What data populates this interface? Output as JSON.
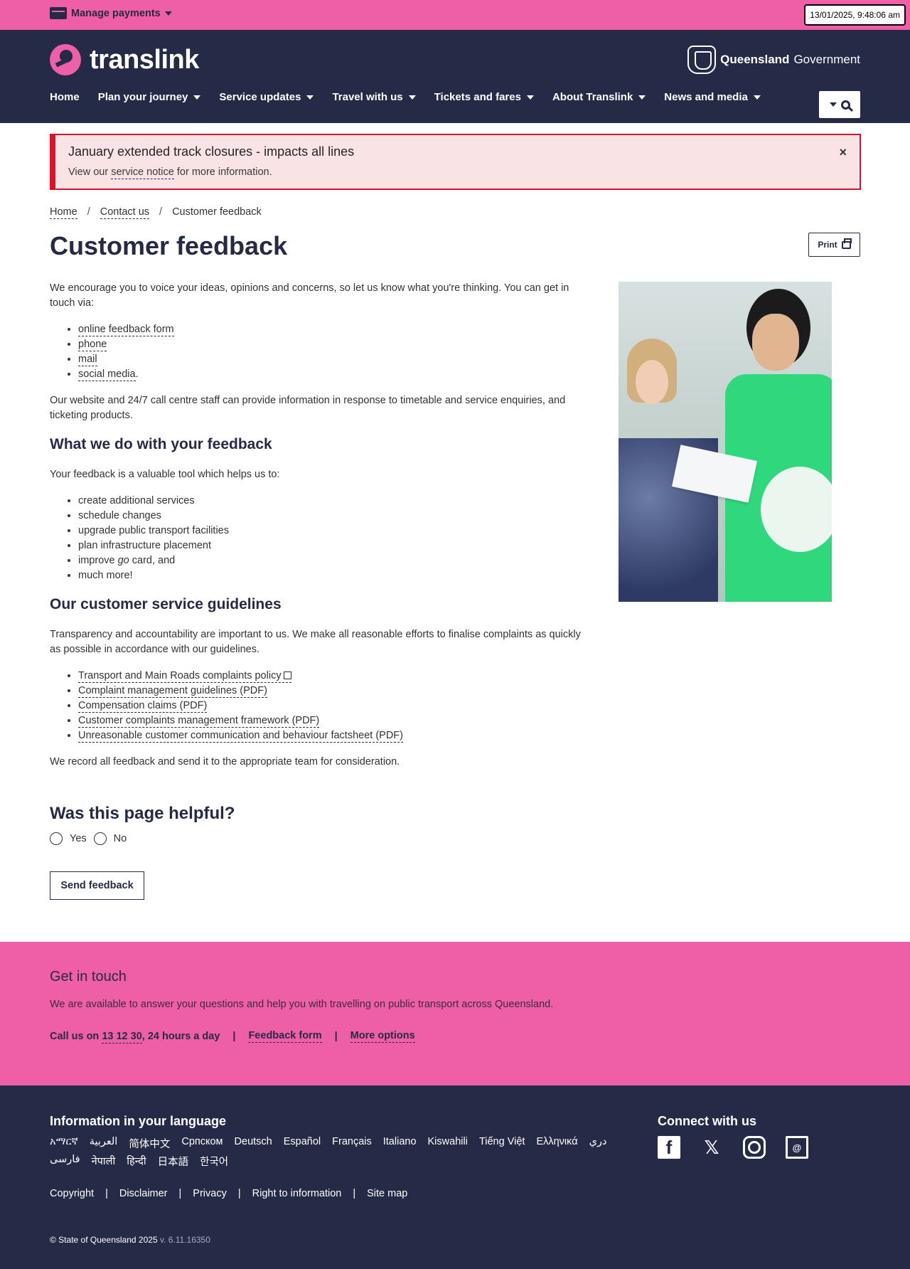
{
  "topbar": {
    "manage_label": "Manage payments",
    "timestamp": "13/01/2025, 9:48:06 am"
  },
  "header": {
    "logo_text": "translink",
    "qgov_bold": "Queensland",
    "qgov_rest": " Government",
    "nav": [
      "Home",
      "Plan your journey",
      "Service updates",
      "Travel with us",
      "Tickets and fares",
      "About Translink",
      "News and media"
    ]
  },
  "alert": {
    "title": "January extended track closures - impacts all lines",
    "text_before": "View our ",
    "link": "service notice",
    "text_after": " for more information.",
    "close": "×"
  },
  "breadcrumb": [
    "Home",
    "/",
    "Contact us",
    "/",
    "Customer feedback"
  ],
  "page": {
    "title": "Customer feedback",
    "print_label": "Print",
    "intro": "We encourage you to voice your ideas, opinions and concerns, so let us know what you're thinking. You can get in touch via:",
    "contact_links": [
      "online feedback form",
      "phone",
      "mail",
      "social media"
    ],
    "social_suffix": ".",
    "website_text": "Our website and 24/7 call centre staff can provide information in response to timetable and service enquiries, and ticketing products.",
    "h_what": "What we do with your feedback",
    "what_intro": "Your feedback is a valuable tool which helps us to:",
    "what_items": [
      "create additional services",
      "schedule changes",
      "upgrade public transport facilities",
      "plan infrastructure placement"
    ],
    "improve_before": "improve ",
    "improve_go": "go",
    "improve_after": " card, and",
    "much_more": "much more!",
    "h_guidelines": "Our customer service guidelines",
    "guidelines_intro": "Transparency and accountability are important to us. We make all reasonable efforts to finalise complaints as quickly as possible in accordance with our guidelines.",
    "guideline_links": [
      "Transport and Main Roads complaints policy",
      "Complaint management guidelines (PDF)",
      "Compensation claims (PDF)",
      "Customer complaints management framework (PDF)",
      "Unreasonable customer communication and behaviour factsheet (PDF)"
    ],
    "record_text": "We record all feedback and send it to the appropriate team for consideration."
  },
  "helpful": {
    "title": "Was this page helpful?",
    "yes": "Yes",
    "no": "No",
    "send": "Send feedback"
  },
  "get_in_touch": {
    "title": "Get in touch",
    "text": "We are available to answer your questions and help you with travelling on public transport across Queensland.",
    "call_before": "Call us on ",
    "phone": "13 12 30",
    "call_after": ", 24 hours a day",
    "sep": "|",
    "feedback_form": "Feedback form",
    "more_options": "More options"
  },
  "footer": {
    "lang_title": "Information in your language",
    "languages": [
      "አማርኛ",
      "العربية",
      "简体中文",
      "Српском",
      "Deutsch",
      "Español",
      "Français",
      "Italiano",
      "Kiswahili",
      "Tiếng Việt",
      "Ελληνικά",
      "دري",
      "فارسی",
      "नेपाली",
      "हिन्दी",
      "日本語",
      "한국어"
    ],
    "connect_title": "Connect with us",
    "links": [
      "Copyright",
      "|",
      "Disclaimer",
      "|",
      "Privacy",
      "|",
      "Right to information",
      "|",
      "Site map"
    ],
    "copyright": "© State of Queensland 2025",
    "version": " v. 6.11.16350"
  },
  "colors": {
    "pink": "#ef5fa7",
    "navy": "#252a46",
    "alert_red": "#e0102a",
    "alert_bg": "#f9e3e5",
    "green_shirt": "#2fd87d"
  },
  "icons": [
    "card-icon",
    "chevron-down-icon",
    "search-icon",
    "close-icon",
    "printer-icon",
    "external-link-icon",
    "facebook-icon",
    "x-icon",
    "instagram-icon",
    "email-icon",
    "queensland-crest-icon",
    "translink-logo-icon"
  ]
}
